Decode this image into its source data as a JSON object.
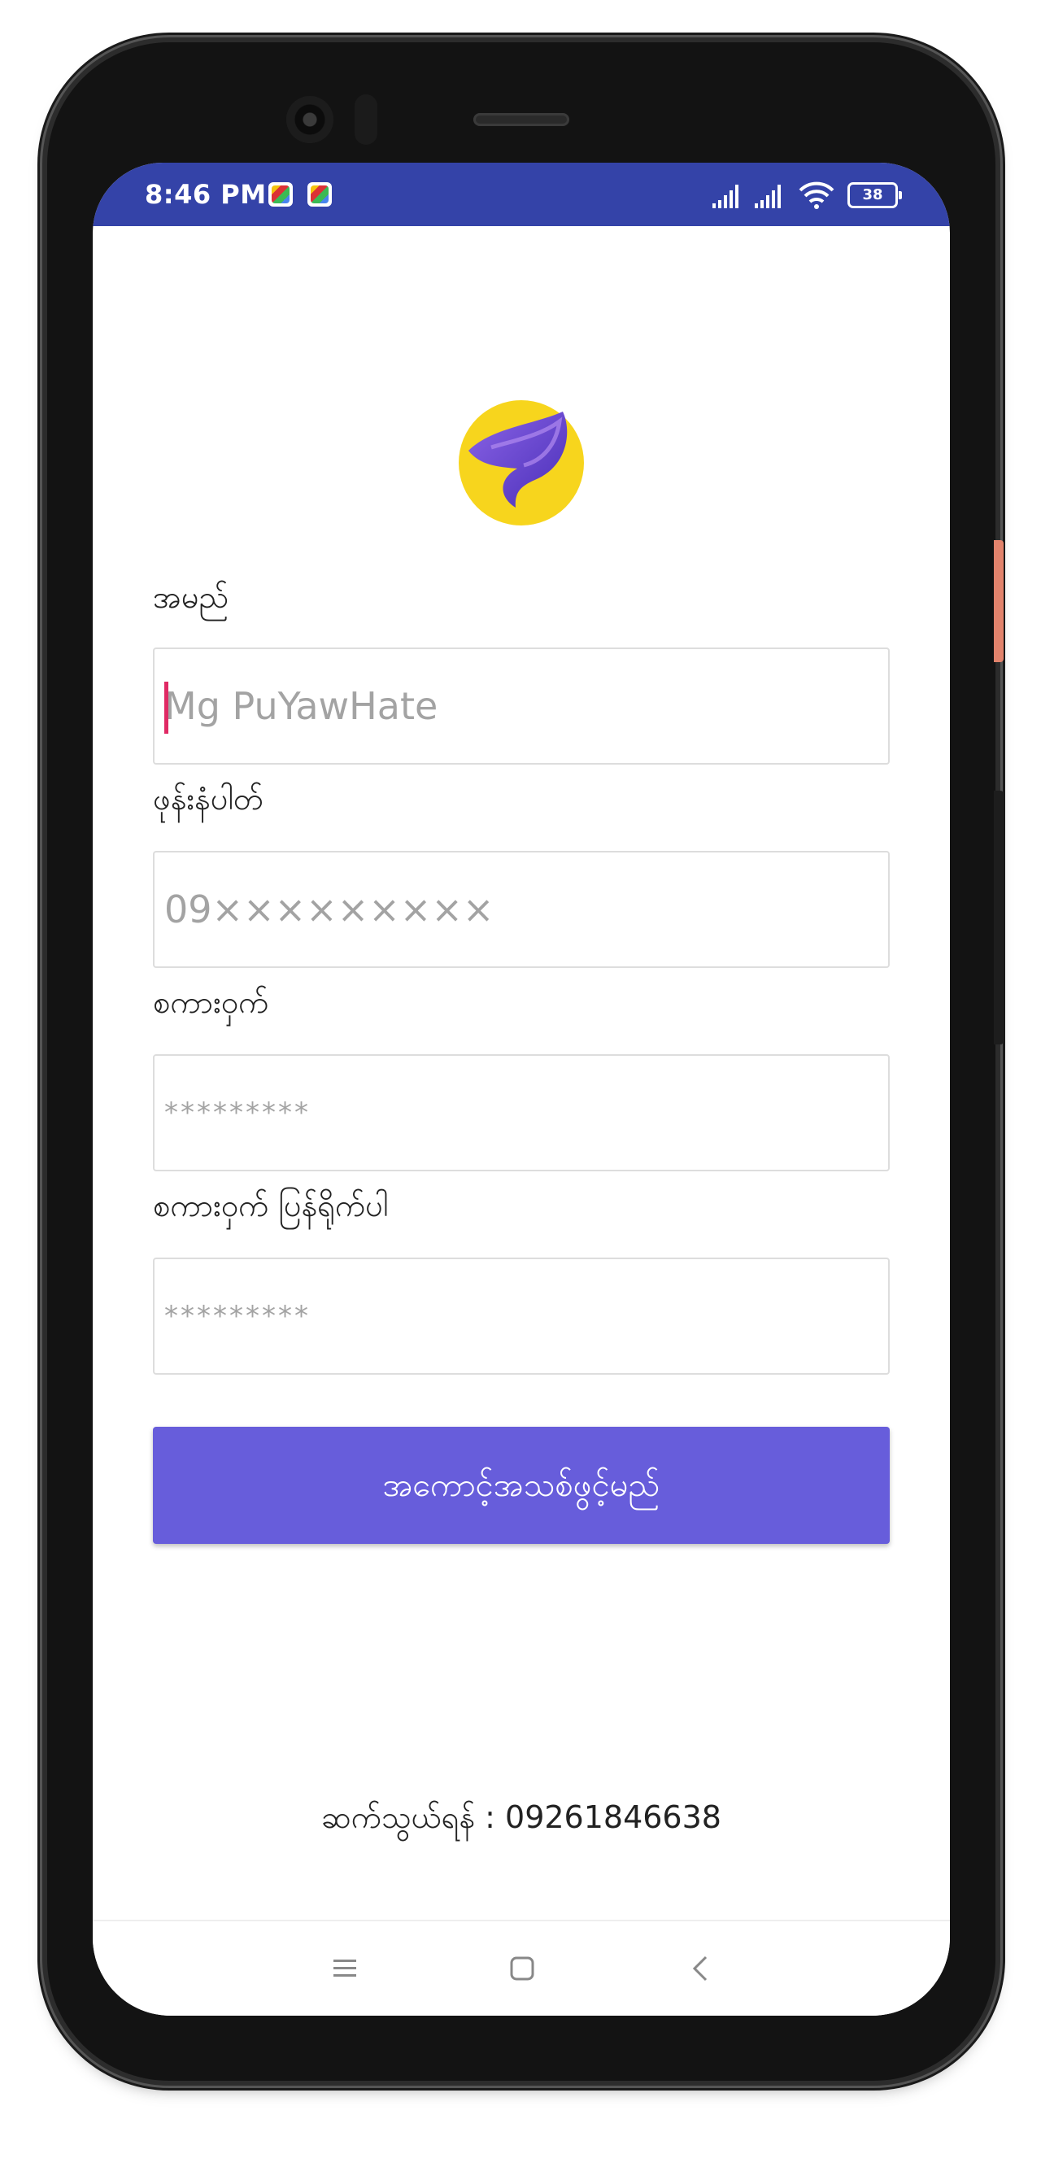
{
  "status_bar": {
    "time": "8:46 PM",
    "battery": "38",
    "notification_icons": [
      "play-games-icon",
      "play-games-icon"
    ],
    "system_icons": [
      "signal-icon",
      "signal-icon",
      "wifi-icon",
      "battery-icon"
    ],
    "background_color": "#3443a8"
  },
  "form": {
    "name": {
      "label": "အမည်",
      "placeholder": "Mg PuYawHate",
      "focused": true
    },
    "phone": {
      "label": "ဖုန်းနံပါတ်",
      "placeholder": "09×××××××××"
    },
    "password": {
      "label": "စကားဝှက်",
      "placeholder": "*********"
    },
    "confirm_password": {
      "label": "စကားဝှက် ပြန်ရိုက်ပါ",
      "placeholder": "*********"
    },
    "submit_label": "အကောင့်အသစ်ဖွင့်မည်"
  },
  "contact_text": "ဆက်သွယ်ရန် : 09261846638",
  "nav_bar": {
    "icons": [
      "menu-icon",
      "home-icon",
      "back-icon"
    ]
  },
  "colors": {
    "accent": "#675ddb",
    "cursor": "#e02964",
    "logo_background": "#f7d51d",
    "logo_mark": "#6d3fd1"
  }
}
